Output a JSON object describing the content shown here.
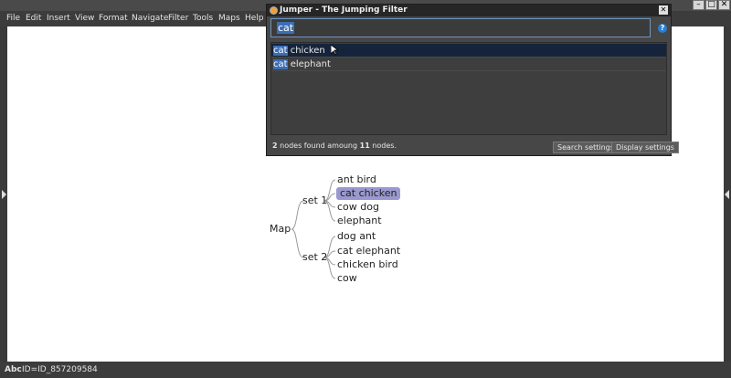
{
  "window": {
    "title": "",
    "controls": [
      "minimize",
      "maximize",
      "close"
    ]
  },
  "menu": [
    "File",
    "Edit",
    "Insert",
    "View",
    "Format",
    "Navigate",
    "Filter",
    "Tools",
    "Maps",
    "Help"
  ],
  "mindmap": {
    "root": "Map",
    "set1": {
      "label": "set 1",
      "children": [
        "ant bird",
        "cat chicken",
        "cow dog",
        "elephant"
      ]
    },
    "set2": {
      "label": "set 2",
      "children": [
        "dog ant",
        "cat elephant",
        "chicken bird",
        "cow"
      ]
    },
    "highlight_color": "#9b98cf"
  },
  "jumper": {
    "title": "Jumper - The Jumping Filter",
    "close_glyph": "✕",
    "query": "cat",
    "help_glyph": "?",
    "results": [
      {
        "match": "cat",
        "rest": " chicken",
        "selected": true
      },
      {
        "match": "cat",
        "rest": " elephant",
        "selected": false
      }
    ],
    "summary": {
      "found": "2",
      "middle": " nodes found amoung ",
      "total": "11",
      "suffix": " nodes."
    },
    "buttons": {
      "search_settings": "Search settings",
      "display_settings": "Display settings"
    }
  },
  "status": {
    "icon_label": "Abc",
    "id_text": "ID=ID_857209584"
  },
  "colors": {
    "chrome": "#3c3c3c",
    "canvas": "#ffffff",
    "selection_blue": "#3c6eb4",
    "active_row": "#15243b"
  }
}
